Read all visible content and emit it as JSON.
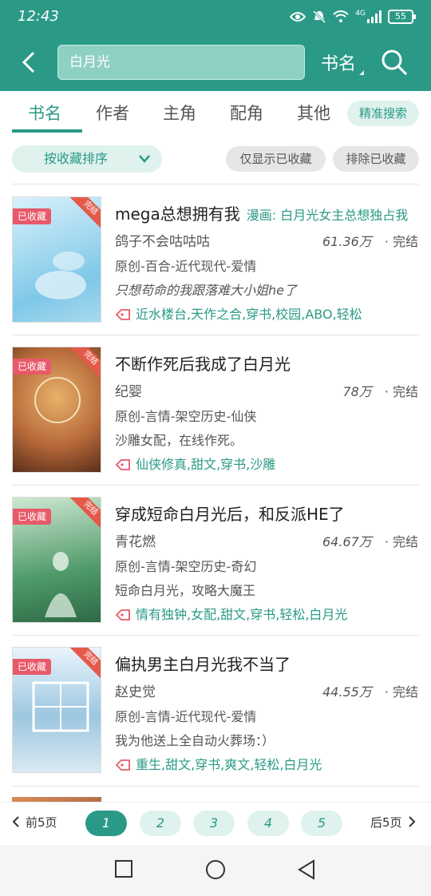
{
  "status_bar": {
    "time": "12:43",
    "network": "4G",
    "battery": "55"
  },
  "search": {
    "query": "白月光",
    "type_label": "书名"
  },
  "tabs": [
    {
      "label": "书名"
    },
    {
      "label": "作者"
    },
    {
      "label": "主角"
    },
    {
      "label": "配角"
    },
    {
      "label": "其他"
    }
  ],
  "precise_search_label": "精准搜索",
  "filters": {
    "sort_label": "按收藏排序",
    "only_collected": "仅显示已收藏",
    "exclude_collected": "排除已收藏"
  },
  "books": [
    {
      "title": "mega总想拥有我",
      "subtitle": "漫画: 白月光女主总想独占我",
      "author": "鸽子不会咕咕咕",
      "words": "61.36万",
      "status": "· 完结",
      "genre": "原创-百合-近代现代-爱情",
      "desc": "只想苟命的我跟落难大小姐he了",
      "tags": "近水楼台,天作之合,穿书,校园,ABO,轻松",
      "badge": "已收藏",
      "ribbon": "完结",
      "cover_color": "#7fc8e8"
    },
    {
      "title": "不断作死后我成了白月光",
      "subtitle": "",
      "author": "纪婴",
      "words": "78万",
      "status": "· 完结",
      "genre": "原创-言情-架空历史-仙侠",
      "desc": "沙雕女配，在线作死。",
      "tags": "仙侠修真,甜文,穿书,沙雕",
      "badge": "已收藏",
      "ribbon": "完结",
      "cover_color": "#b86a3a"
    },
    {
      "title": "穿成短命白月光后，和反派HE了",
      "subtitle": "",
      "author": "青花燃",
      "words": "64.67万",
      "status": "· 完结",
      "genre": "原创-言情-架空历史-奇幻",
      "desc": "短命白月光，攻略大魔王",
      "tags": "情有独钟,女配,甜文,穿书,轻松,白月光",
      "badge": "已收藏",
      "ribbon": "完结",
      "cover_color": "#4f9a6a"
    },
    {
      "title": "偏执男主白月光我不当了",
      "subtitle": "",
      "author": "赵史觉",
      "words": "44.55万",
      "status": "· 完结",
      "genre": "原创-言情-近代现代-爱情",
      "desc": "我为他送上全自动火葬场：）",
      "tags": "重生,甜文,穿书,爽文,轻松,白月光",
      "badge": "已收藏",
      "ribbon": "完结",
      "cover_color": "#9cc7e0"
    }
  ],
  "pagination": {
    "prev_label": "前5页",
    "next_label": "后5页",
    "pages": [
      "1",
      "2",
      "3",
      "4",
      "5"
    ],
    "current": "1"
  }
}
